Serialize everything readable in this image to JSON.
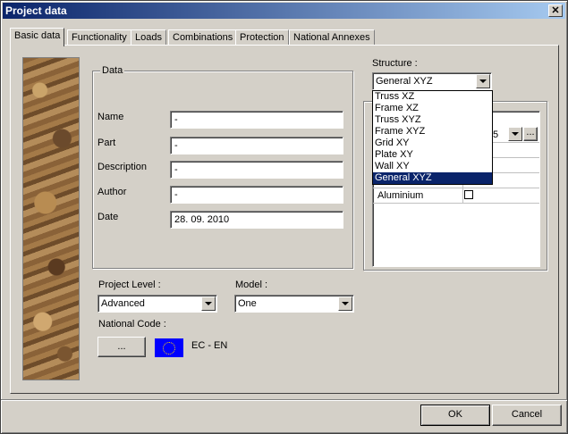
{
  "window": {
    "title": "Project data",
    "close_label": "✕"
  },
  "tabs": [
    {
      "label": "Basic data"
    },
    {
      "label": "Functionality"
    },
    {
      "label": "Loads"
    },
    {
      "label": "Combinations"
    },
    {
      "label": "Protection"
    },
    {
      "label": "National Annexes"
    }
  ],
  "data_group": {
    "legend": "Data",
    "fields": {
      "name": {
        "label": "Name",
        "value": "-"
      },
      "part": {
        "label": "Part",
        "value": "-"
      },
      "description": {
        "label": "Description",
        "value": "-"
      },
      "author": {
        "label": "Author",
        "value": "-"
      },
      "date": {
        "label": "Date",
        "value": "28. 09. 2010"
      }
    }
  },
  "structure": {
    "label": "Structure :",
    "selected": "General XYZ",
    "options": [
      "Truss XZ",
      "Frame XZ",
      "Truss XYZ",
      "Frame XYZ",
      "Grid XY",
      "Plate XY",
      "Wall XY",
      "General XYZ"
    ]
  },
  "materials_grid": {
    "partial_value": "5",
    "ellipsis": "...",
    "aluminium_label": "Aluminium"
  },
  "project_level": {
    "label": "Project Level :",
    "selected": "Advanced"
  },
  "model": {
    "label": "Model :",
    "selected": "One"
  },
  "national_code": {
    "label": "National Code :",
    "button_label": "...",
    "code_text": "EC - EN"
  },
  "footer": {
    "ok_label": "OK",
    "cancel_label": "Cancel"
  },
  "colors": {
    "title_bar": "#0a246a",
    "selection": "#0a246a",
    "flag": "#0000ff",
    "face": "#d4d0c8"
  }
}
